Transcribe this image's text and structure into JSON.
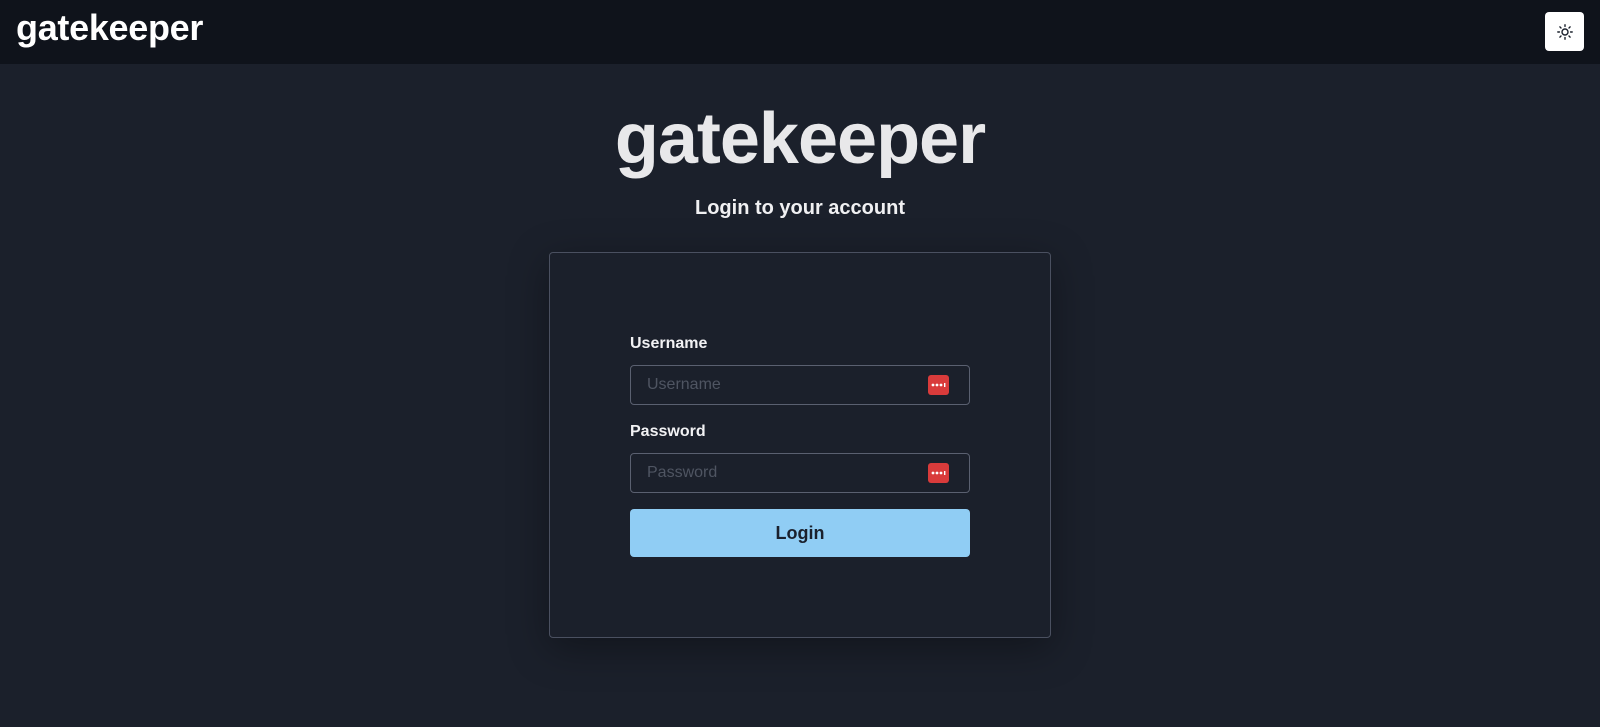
{
  "header": {
    "brand": "gatekeeper",
    "theme_toggle_icon": "sun-icon"
  },
  "hero": {
    "title": "gatekeeper",
    "subtitle": "Login to your account"
  },
  "form": {
    "username": {
      "label": "Username",
      "placeholder": "Username",
      "value": ""
    },
    "password": {
      "label": "Password",
      "placeholder": "Password",
      "value": ""
    },
    "submit_label": "Login"
  },
  "colors": {
    "background": "#1b202b",
    "topbar": "#0f131b",
    "accent": "#90cdf4",
    "password_manager_icon": "#d93b3b"
  }
}
